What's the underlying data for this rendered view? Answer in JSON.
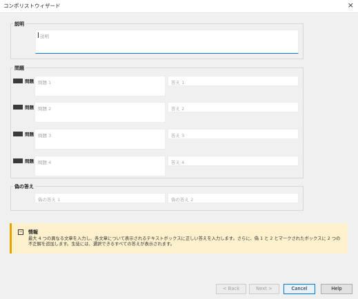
{
  "window": {
    "title": "コンポリストウィザード",
    "close_glyph": "×"
  },
  "description": {
    "label": "説明",
    "placeholder": "説明"
  },
  "questions": {
    "label": "問題",
    "items": [
      {
        "label": "問題 1",
        "q_placeholder": "問題 1",
        "a_placeholder": "答え 1"
      },
      {
        "label": "問題 2",
        "q_placeholder": "問題 2",
        "a_placeholder": "答え 2"
      },
      {
        "label": "問題 3",
        "q_placeholder": "問題 3",
        "a_placeholder": "答え 3"
      },
      {
        "label": "問題 4",
        "q_placeholder": "問題 4",
        "a_placeholder": "答え 4"
      }
    ]
  },
  "distractors": {
    "label": "偽の答え",
    "items": [
      {
        "placeholder": "偽の答え 1"
      },
      {
        "placeholder": "偽の答え 2"
      }
    ]
  },
  "info": {
    "icon": "info-icon",
    "title": "情報",
    "body": "最大 4 つの異なる文章を入力し、各文章について表示されるテキストボックスに正しい答えを入力します。さらに、偽 1 と 2 とマークされたボックスに 2 つの不正解を追加します。生徒には、選択できるすべての答えが表示されます。"
  },
  "buttons": {
    "back": "< Back",
    "next": "Next >",
    "cancel": "Cancel",
    "help": "Help"
  },
  "colors": {
    "accent": "#0078d7",
    "info_bg": "#fdf0cc",
    "info_border": "#e8a200"
  }
}
